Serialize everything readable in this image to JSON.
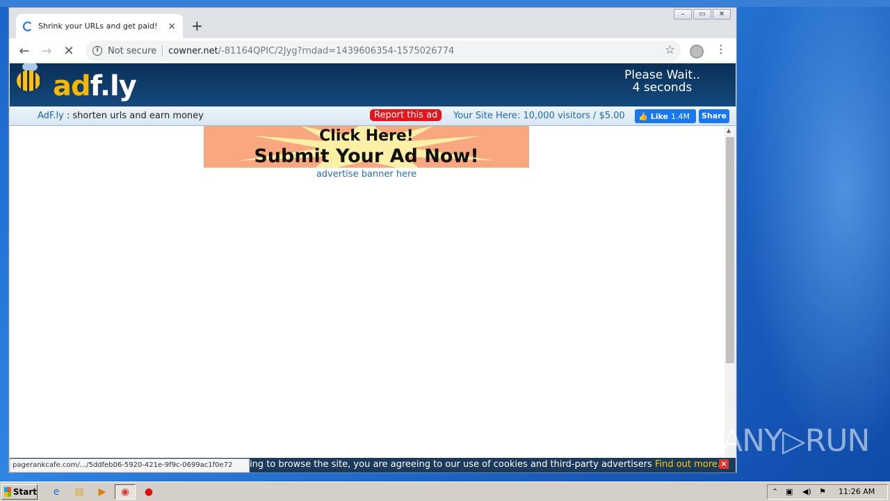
{
  "browser": {
    "tab_title": "Shrink your URLs and get paid!",
    "tab_close": "×",
    "new_tab": "+",
    "not_secure": "Not secure",
    "url_host": "cowner.net",
    "url_path": "/-81164QPIC/2Jyg?rndad=1439606354-1575026774",
    "status_url": "pagerankcafe.com/.../5ddfeb06-5920-421e-9f9c-0699ac1f0e72"
  },
  "adfly": {
    "logo_a": "ad",
    "logo_f": "f.ly",
    "wait_line1": "Please Wait..",
    "wait_line2": "4 seconds",
    "brand": "AdF.ly",
    "tagline": " : shorten urls and earn money",
    "report_label": "Report this ad",
    "your_site": "Your Site Here: 10,000 visitors / $5.00",
    "fb_like": "Like",
    "fb_count": "1.4M",
    "fb_share": "Share",
    "banner_line1": "Click Here!",
    "banner_line2": "Submit Your Ad Now!",
    "advertise_link": "advertise banner here",
    "cookie_text": "ing to browse the site, you are agreeing to our use of cookies and third-party advertisers ",
    "cookie_link": "Find out more.",
    "cookie_close": "×"
  },
  "watermark": "ANY▷RUN",
  "taskbar": {
    "start": "Start",
    "clock": "11:26 AM"
  },
  "colors": {
    "adfly_header": "#0a2f57",
    "report_red": "#e8121a",
    "facebook_blue": "#1877f2",
    "cookie_link_yellow": "#f5d000"
  }
}
